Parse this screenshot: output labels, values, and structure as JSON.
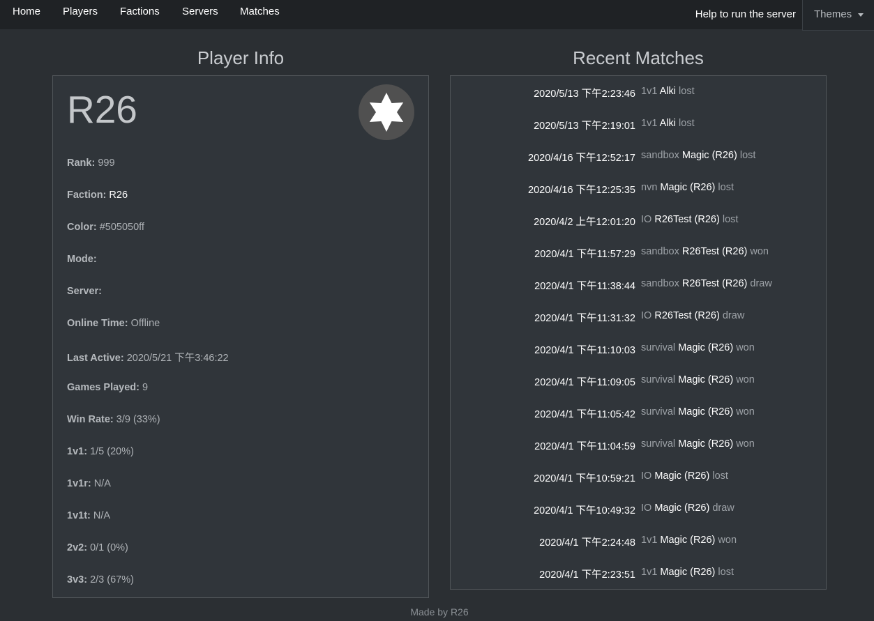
{
  "nav": {
    "home": "Home",
    "players": "Players",
    "factions": "Factions",
    "servers": "Servers",
    "matches": "Matches",
    "help": "Help to run the server",
    "themes": "Themes"
  },
  "player_info": {
    "title": "Player Info",
    "name": "R26",
    "avatar_icon": "star-icon",
    "rows": [
      {
        "key": "Rank:",
        "value": "999"
      },
      {
        "key": "Faction:",
        "value": "R26"
      },
      {
        "key": "Color:",
        "value": "#505050ff"
      },
      {
        "key": "Mode:",
        "value": ""
      },
      {
        "key": "Server:",
        "value": ""
      },
      {
        "key": "Online Time:",
        "value": "Offline"
      },
      {
        "key": "Last Active:",
        "value": "2020/5/21 下午3:46:22"
      },
      {
        "key": "Games Played:",
        "value": "9"
      },
      {
        "key": "Win Rate:",
        "value": "3/9 (33%)"
      },
      {
        "key": "1v1:",
        "value": "1/5 (20%)"
      },
      {
        "key": "1v1r:",
        "value": "N/A"
      },
      {
        "key": "1v1t:",
        "value": "N/A"
      },
      {
        "key": "2v2:",
        "value": "0/1 (0%)"
      },
      {
        "key": "3v3:",
        "value": "2/3 (67%)"
      }
    ]
  },
  "recent_matches": {
    "title": "Recent Matches",
    "items": [
      {
        "time": "2020/5/13 下午2:23:46",
        "mode": "1v1",
        "player": "Alki",
        "result": "lost"
      },
      {
        "time": "2020/5/13 下午2:19:01",
        "mode": "1v1",
        "player": "Alki",
        "result": "lost"
      },
      {
        "time": "2020/4/16 下午12:52:17",
        "mode": "sandbox",
        "player": "Magic (R26)",
        "result": "lost"
      },
      {
        "time": "2020/4/16 下午12:25:35",
        "mode": "nvn",
        "player": "Magic (R26)",
        "result": "lost"
      },
      {
        "time": "2020/4/2 上午12:01:20",
        "mode": "IO",
        "player": "R26Test (R26)",
        "result": "lost"
      },
      {
        "time": "2020/4/1 下午11:57:29",
        "mode": "sandbox",
        "player": "R26Test (R26)",
        "result": "won"
      },
      {
        "time": "2020/4/1 下午11:38:44",
        "mode": "sandbox",
        "player": "R26Test (R26)",
        "result": "draw"
      },
      {
        "time": "2020/4/1 下午11:31:32",
        "mode": "IO",
        "player": "R26Test (R26)",
        "result": "draw"
      },
      {
        "time": "2020/4/1 下午11:10:03",
        "mode": "survival",
        "player": "Magic (R26)",
        "result": "won"
      },
      {
        "time": "2020/4/1 下午11:09:05",
        "mode": "survival",
        "player": "Magic (R26)",
        "result": "won"
      },
      {
        "time": "2020/4/1 下午11:05:42",
        "mode": "survival",
        "player": "Magic (R26)",
        "result": "won"
      },
      {
        "time": "2020/4/1 下午11:04:59",
        "mode": "survival",
        "player": "Magic (R26)",
        "result": "won"
      },
      {
        "time": "2020/4/1 下午10:59:21",
        "mode": "IO",
        "player": "Magic (R26)",
        "result": "lost"
      },
      {
        "time": "2020/4/1 下午10:49:32",
        "mode": "IO",
        "player": "Magic (R26)",
        "result": "draw"
      },
      {
        "time": "2020/4/1 下午2:24:48",
        "mode": "1v1",
        "player": "Magic (R26)",
        "result": "won"
      },
      {
        "time": "2020/4/1 下午2:23:51",
        "mode": "1v1",
        "player": "Magic (R26)",
        "result": "lost"
      }
    ]
  },
  "footer": "Made by R26"
}
